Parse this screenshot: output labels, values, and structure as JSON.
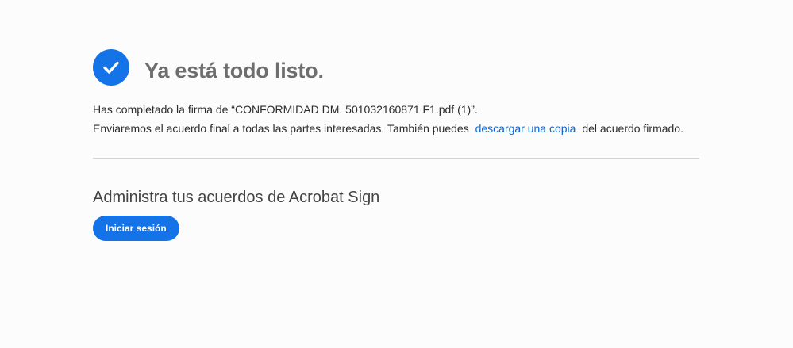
{
  "success": {
    "icon": "checkmark-circle-icon",
    "title": "Ya está todo listo."
  },
  "message": {
    "line1": "Has completado la firma de “CONFORMIDAD DM. 501032160871 F1.pdf (1)”.",
    "line2_before": "Enviaremos el acuerdo final a todas las partes interesadas. También puedes",
    "download_link": "descargar una copia",
    "line2_after": "del acuerdo firmado."
  },
  "manage": {
    "heading": "Administra tus acuerdos de Acrobat Sign",
    "signin_label": "Iniciar sesión"
  },
  "colors": {
    "accent": "#1473e6",
    "link": "#0d66d0",
    "title_gray": "#6e6e6e",
    "divider": "#d3d3d3"
  }
}
